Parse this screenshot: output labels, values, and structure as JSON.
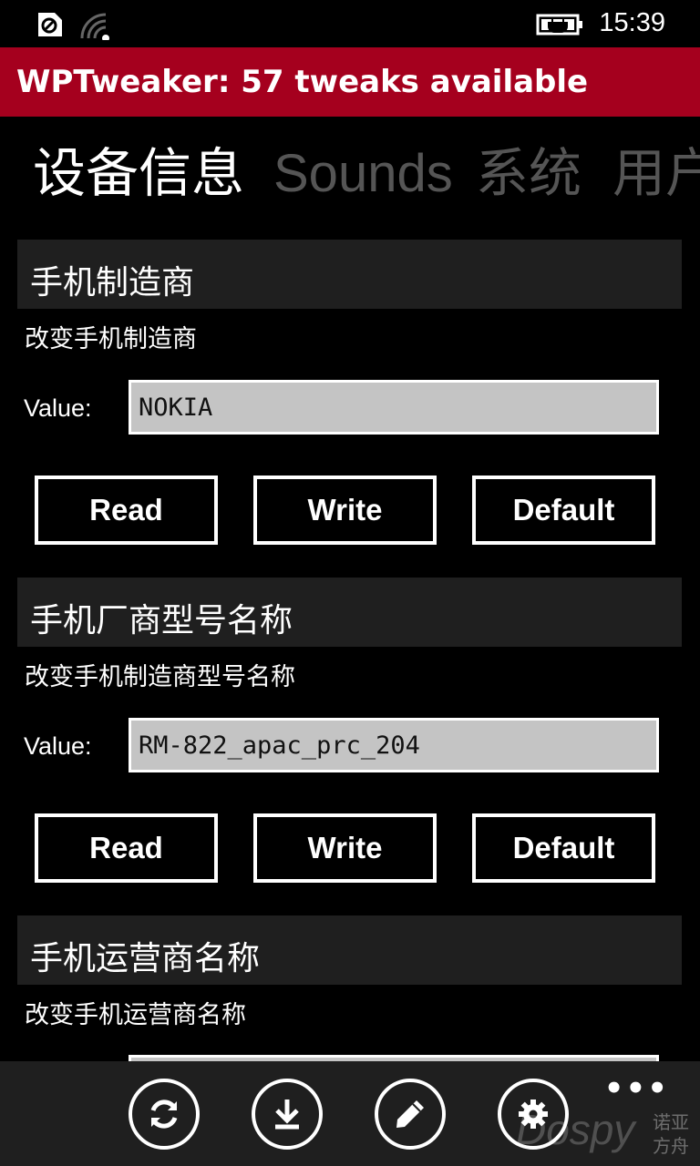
{
  "status_bar": {
    "time": "15:39",
    "icons": [
      "sync-icon",
      "signal-icon",
      "battery-charging-icon"
    ]
  },
  "app": {
    "title": "WPTweaker: 57 tweaks available"
  },
  "pivot": {
    "items": [
      {
        "label": "设备信息",
        "active": true
      },
      {
        "label": "Sounds",
        "active": false
      },
      {
        "label": "系统",
        "active": false
      },
      {
        "label": "用户",
        "active": false
      }
    ]
  },
  "sections": [
    {
      "header": "手机制造商",
      "description": "改变手机制造商",
      "value_label": "Value:",
      "value": "NOKIA",
      "buttons": {
        "read": "Read",
        "write": "Write",
        "default": "Default"
      }
    },
    {
      "header": "手机厂商型号名称",
      "description": "改变手机制造商型号名称",
      "value_label": "Value:",
      "value": "RM-822_apac_prc_204",
      "buttons": {
        "read": "Read",
        "write": "Write",
        "default": "Default"
      }
    },
    {
      "header": "手机运营商名称",
      "description": "改变手机运营商名称",
      "value_label": "Value:",
      "value": ""
    }
  ],
  "app_bar": {
    "buttons": [
      "refresh-icon",
      "download-icon",
      "edit-icon",
      "settings-icon"
    ],
    "more": "•••",
    "watermark": "Dospy",
    "watermark_cn": "诺亚方舟"
  },
  "colors": {
    "accent": "#a5001e",
    "header_bg": "#1f1f1f",
    "input_bg": "#c4c4c4",
    "inactive_pivot": "#555555"
  }
}
